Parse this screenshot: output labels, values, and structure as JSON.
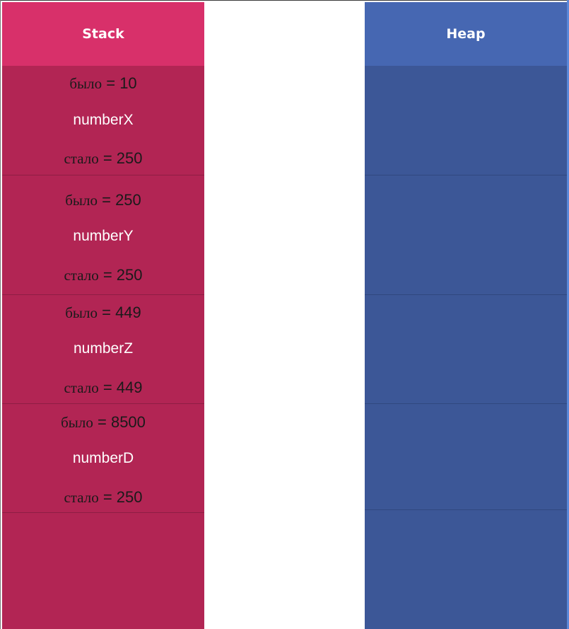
{
  "stack": {
    "title": "Stack",
    "cells": [
      {
        "before_label": "было",
        "before_value": "= 10",
        "name": "numberX",
        "after_label": "стало",
        "after_value": "= 250"
      },
      {
        "before_label": "было",
        "before_value": "= 250",
        "name": "numberY",
        "after_label": "стало",
        "after_value": "= 250"
      },
      {
        "before_label": "было",
        "before_value": "= 449",
        "name": "numberZ",
        "after_label": "стало",
        "after_value": "= 449"
      },
      {
        "before_label": "было",
        "before_value": "= 8500",
        "name": "numberD",
        "after_label": "стало",
        "after_value": "= 250"
      }
    ]
  },
  "heap": {
    "title": "Heap"
  },
  "colors": {
    "stack_header": "#d8306a",
    "stack_body": "#b22554",
    "heap_header": "#4667b2",
    "heap_body": "#3c5797"
  }
}
